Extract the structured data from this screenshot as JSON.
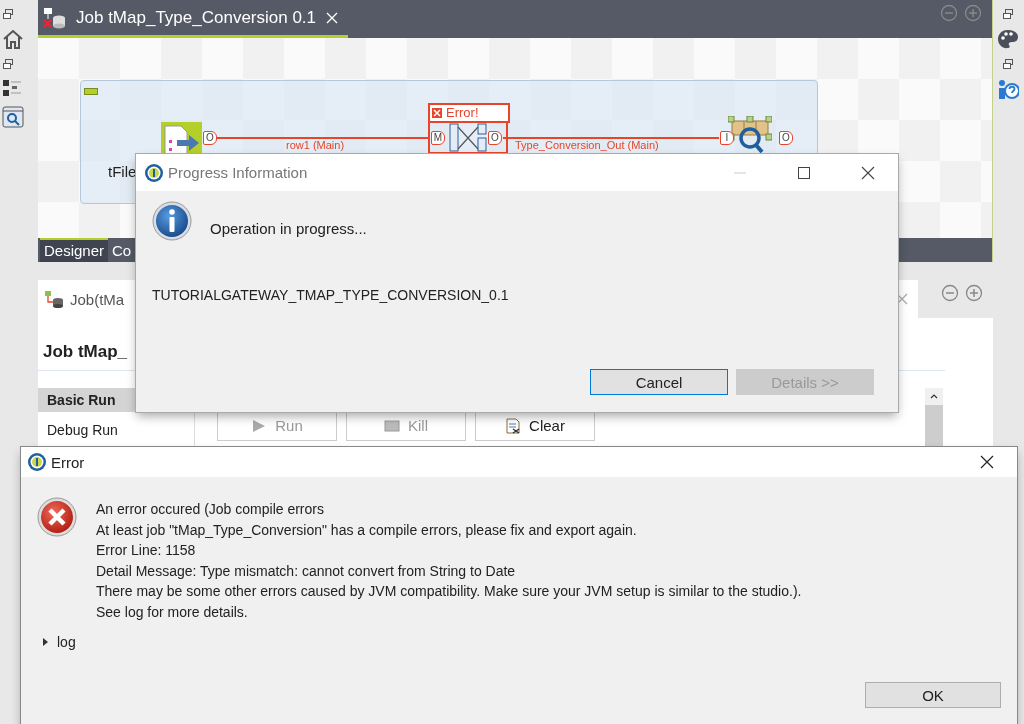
{
  "editor": {
    "tabs": [
      {
        "title": "Job tMap_Type_Conversion 0.1",
        "selected": true
      }
    ],
    "canvas": {
      "nodes": [
        {
          "kind": "input",
          "label": "tFile",
          "ports": [
            "O"
          ]
        },
        {
          "kind": "map",
          "badge": "Error!",
          "ports": [
            "M",
            "O"
          ]
        },
        {
          "kind": "output",
          "ports": [
            "I",
            "O"
          ]
        }
      ],
      "links": [
        {
          "label": "row1 (Main)"
        },
        {
          "label": "Type_Conversion_Out (Main)"
        }
      ]
    },
    "bottom_tabs": [
      {
        "label": "Designer",
        "selected": true
      },
      {
        "label": "Co",
        "selected": false
      }
    ]
  },
  "run_panel": {
    "tab": {
      "title": "Job(tMa"
    },
    "heading": "Job tMap_",
    "menu": [
      {
        "label": "Basic Run",
        "selected": true
      },
      {
        "label": "Debug Run",
        "selected": false
      }
    ],
    "buttons": [
      {
        "kind": "run",
        "label": "Run",
        "disabled": true
      },
      {
        "kind": "kill",
        "label": "Kill",
        "disabled": true
      },
      {
        "kind": "clear",
        "label": "Clear",
        "disabled": false
      }
    ]
  },
  "progress_dialog": {
    "title": "Progress Information",
    "message": "Operation in progress...",
    "job_name": "TUTORIALGATEWAY_TMAP_TYPE_CONVERSION_0.1",
    "buttons": [
      {
        "label": "Cancel",
        "disabled": false,
        "focused": true
      },
      {
        "label": "Details >>",
        "disabled": true,
        "focused": false
      }
    ]
  },
  "error_dialog": {
    "title": "Error",
    "lines": [
      "An error occured (Job compile errors",
      "At least job \"tMap_Type_Conversion\" has a compile errors, please fix and export again.",
      "Error Line: 1158",
      "Detail Message: Type mismatch: cannot convert from String to Date",
      "There may be some other errors caused by JVM compatibility. Make sure your JVM setup is similar to the studio.).",
      "See log for more details."
    ],
    "log": {
      "label": "log",
      "expanded": false
    },
    "buttons": [
      {
        "label": "OK"
      }
    ]
  }
}
